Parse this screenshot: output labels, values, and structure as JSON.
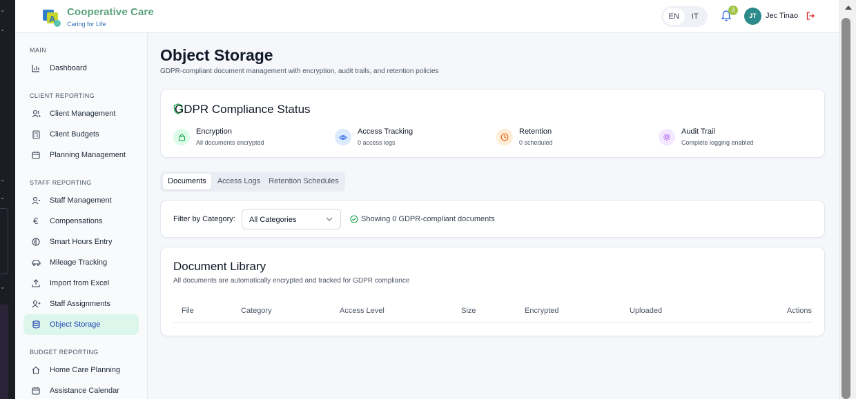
{
  "brand": {
    "name": "Cooperative Care",
    "tagline": "Caring for Life"
  },
  "header": {
    "languages": [
      {
        "code": "EN",
        "active": true
      },
      {
        "code": "IT",
        "active": false
      }
    ],
    "notifications_count": "3",
    "user_initials": "JT",
    "user_name": "Jec Tinao"
  },
  "sidebar": {
    "sections": [
      {
        "title": "MAIN",
        "items": [
          {
            "label": "Dashboard",
            "icon": "bar-chart-icon"
          }
        ]
      },
      {
        "title": "CLIENT REPORTING",
        "items": [
          {
            "label": "Client Management",
            "icon": "users-icon"
          },
          {
            "label": "Client Budgets",
            "icon": "calculator-icon"
          },
          {
            "label": "Planning Management",
            "icon": "calendar-icon"
          }
        ]
      },
      {
        "title": "STAFF REPORTING",
        "items": [
          {
            "label": "Staff Management",
            "icon": "user-cog-icon"
          },
          {
            "label": "Compensations",
            "icon": "euro-icon"
          },
          {
            "label": "Smart Hours Entry",
            "icon": "smart-hours-icon"
          },
          {
            "label": "Mileage Tracking",
            "icon": "car-icon"
          },
          {
            "label": "Import from Excel",
            "icon": "upload-icon"
          },
          {
            "label": "Staff Assignments",
            "icon": "user-plus-icon"
          },
          {
            "label": "Object Storage",
            "icon": "database-icon",
            "active": true
          }
        ]
      },
      {
        "title": "BUDGET REPORTING",
        "items": [
          {
            "label": "Home Care Planning",
            "icon": "home-icon"
          },
          {
            "label": "Assistance Calendar",
            "icon": "calendar-icon"
          }
        ]
      }
    ]
  },
  "page": {
    "title": "Object Storage",
    "subtitle": "GDPR-compliant document management with encryption, audit trails, and retention policies"
  },
  "gdpr": {
    "title": "GDPR Compliance Status",
    "features": [
      {
        "title": "Encryption",
        "desc": "All documents encrypted",
        "icon": "lock-icon",
        "color": "#16a34a",
        "bg": "#dcfce7"
      },
      {
        "title": "Access Tracking",
        "desc": "0 access logs",
        "icon": "eye-icon",
        "color": "#2563eb",
        "bg": "#dbeafe"
      },
      {
        "title": "Retention",
        "desc": "0 scheduled",
        "icon": "clock-icon",
        "color": "#ea580c",
        "bg": "#ffedd5"
      },
      {
        "title": "Audit Trail",
        "desc": "Complete logging enabled",
        "icon": "cog-icon",
        "color": "#9333ea",
        "bg": "#f3e8ff"
      }
    ]
  },
  "tabs": [
    {
      "label": "Documents",
      "active": true
    },
    {
      "label": "Access Logs",
      "active": false
    },
    {
      "label": "Retention Schedules",
      "active": false
    }
  ],
  "filter": {
    "label": "Filter by Category:",
    "selected": "All Categories",
    "status": "Showing 0 GDPR-compliant documents"
  },
  "library": {
    "title": "Document Library",
    "subtitle": "All documents are automatically encrypted and tracked for GDPR compliance",
    "columns": [
      "File",
      "Category",
      "Access Level",
      "Size",
      "Encrypted",
      "Uploaded",
      "Actions"
    ]
  }
}
